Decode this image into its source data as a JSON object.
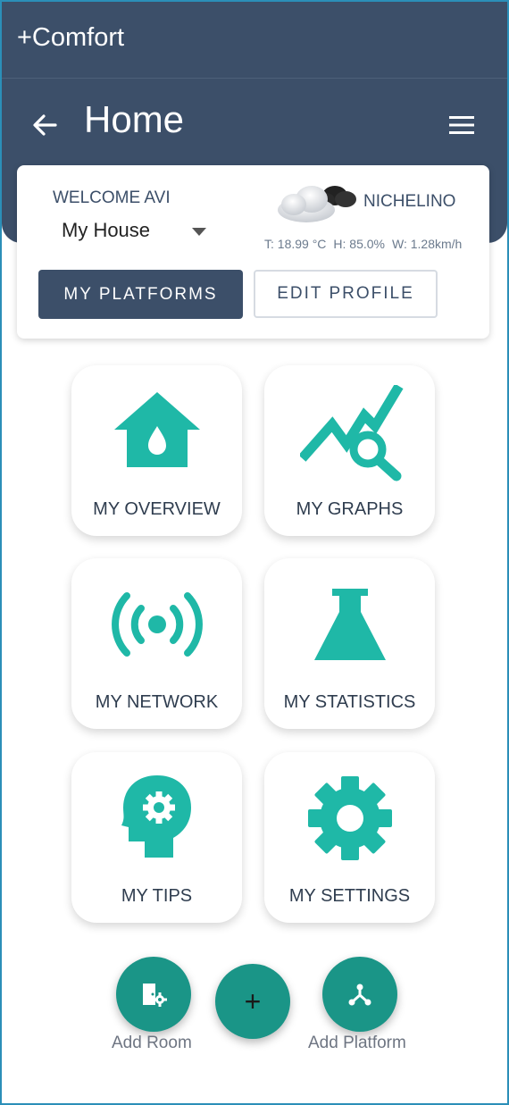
{
  "app": {
    "title": "+Comfort"
  },
  "header": {
    "title": "Home",
    "back_icon": "arrow-left-icon",
    "menu_icon": "hamburger-menu-icon"
  },
  "welcome_card": {
    "greeting": "WELCOME AVI",
    "house": {
      "selected": "My House"
    },
    "location": "NICHELINO",
    "weather_icon": "cloudy-icon",
    "weather": {
      "temperature": "T: 18.99 °C",
      "humidity": "H: 85.0%",
      "wind": "W: 1.28km/h"
    },
    "buttons": {
      "my_platforms": "MY PLATFORMS",
      "edit_profile": "EDIT PROFILE"
    }
  },
  "tiles": [
    {
      "label": "MY OVERVIEW",
      "icon": "house-drop-icon"
    },
    {
      "label": "MY GRAPHS",
      "icon": "graph-search-icon"
    },
    {
      "label": "MY NETWORK",
      "icon": "broadcast-icon"
    },
    {
      "label": "MY STATISTICS",
      "icon": "flask-icon"
    },
    {
      "label": "MY TIPS",
      "icon": "head-gear-icon"
    },
    {
      "label": "MY SETTINGS",
      "icon": "gear-icon"
    }
  ],
  "fab": {
    "add_room": "Add Room",
    "add_platform": "Add Platform",
    "main_symbol": "+"
  },
  "colors": {
    "header": "#3c4f69",
    "accent": "#1fb8a7",
    "fab": "#1a9587"
  }
}
